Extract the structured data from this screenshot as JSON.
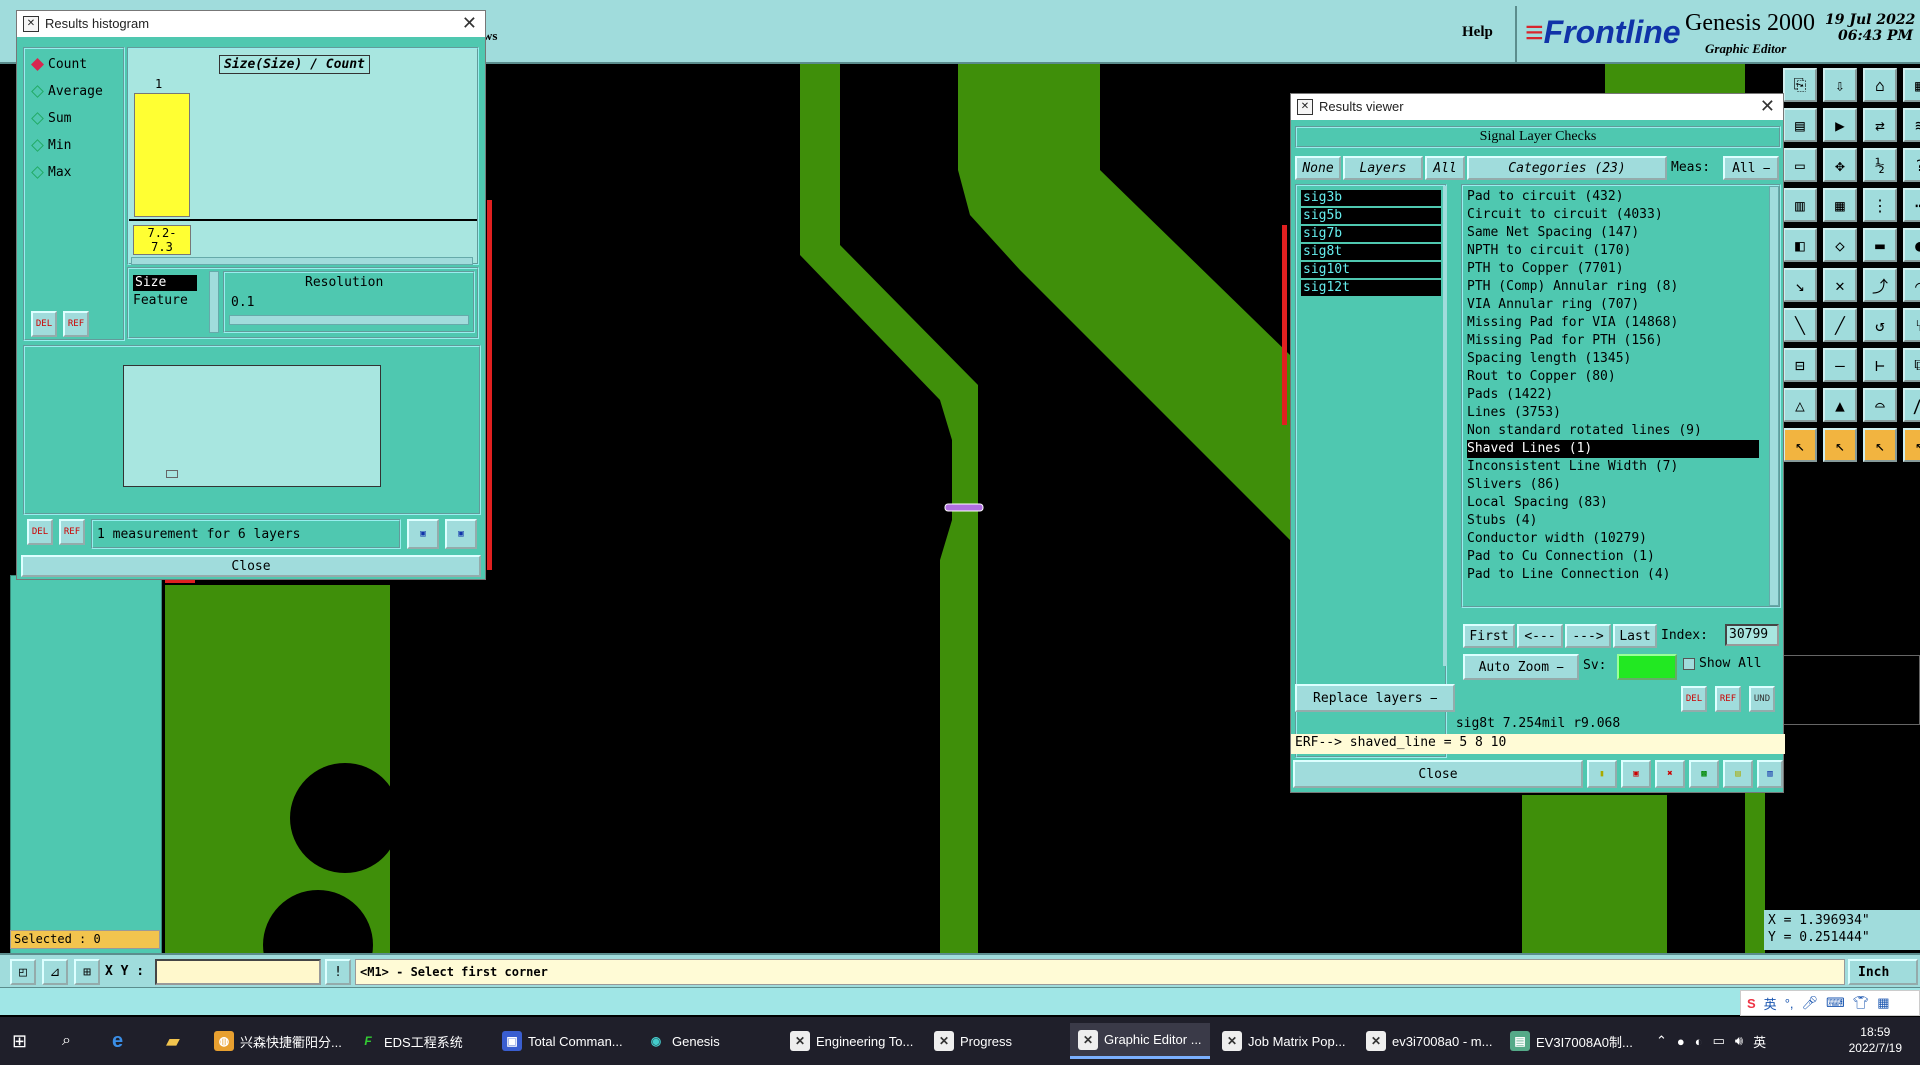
{
  "top_bar": {
    "help_label": "Help",
    "ws_fragment": "ws",
    "logo_text": "Frontline",
    "app_title": "Genesis 2000",
    "app_subtitle": "Graphic Editor",
    "date": "19 Jul 2022",
    "time": "06:43 PM"
  },
  "histogram": {
    "title": "Results histogram",
    "radio_options": [
      "Count",
      "Average",
      "Sum",
      "Min",
      "Max"
    ],
    "selected_option": "Count",
    "chart_title": "Size(Size) / Count",
    "bar_count_label": "1",
    "bar_range_label_1": "7.2-",
    "bar_range_label_2": "7.3",
    "size_label": "Size",
    "feature_label": "Feature",
    "resolution_label": "Resolution",
    "resolution_value": "0.1",
    "measure_text": "1 measurement for 6 layers",
    "close_label": "Close",
    "del_label": "DEL",
    "ref_label": "REF"
  },
  "results_viewer": {
    "title": "Results viewer",
    "header": "Signal Layer Checks",
    "none_label": "None",
    "layers_label": "Layers",
    "all_label": "All",
    "categories_label": "Categories (23)",
    "meas_label": "Meas:",
    "meas_value": "All",
    "layers": [
      "sig3b",
      "sig5b",
      "sig7b",
      "sig8t",
      "sig10t",
      "sig12t"
    ],
    "categories": [
      "Pad to circuit (432)",
      "Circuit to circuit (4033)",
      "Same Net Spacing (147)",
      "NPTH to circuit (170)",
      "PTH to Copper (7701)",
      "PTH (Comp) Annular ring (8)",
      "VIA Annular ring (707)",
      "Missing Pad for VIA (14868)",
      "Missing Pad for PTH (156)",
      "Spacing length (1345)",
      "Rout to Copper (80)",
      "Pads (1422)",
      "Lines (3753)",
      "Non standard rotated lines (9)",
      "Shaved Lines (1)",
      "Inconsistent Line Width (7)",
      "Slivers (86)",
      "Local Spacing (83)",
      "Stubs (4)",
      "Conductor width (10279)",
      "Pad to Cu Connection (1)",
      "Pad to Line Connection (4)"
    ],
    "selected_category": "Shaved Lines (1)",
    "first_label": "First",
    "prev_label": "<---",
    "next_label": "--->",
    "last_label": "Last",
    "index_label": "Index:",
    "index_value": "30799",
    "auto_zoom_label": "Auto Zoom",
    "sv_label": "Sv:",
    "show_all_label": "Show All",
    "replace_layers_label": "Replace layers",
    "status_line": "sig8t 7.254mil  r9.068",
    "erf_line": "ERF--> shaved_line = 5 8 10",
    "close_label": "Close"
  },
  "left_panel": {
    "selected_text": "Selected : 0"
  },
  "coords": {
    "x_text": "X = 1.396934\"",
    "y_text": "Y = 0.251444\""
  },
  "command_bar": {
    "xy_label": "X Y :",
    "xy_value": "",
    "message": "<M1> - Select first corner",
    "unit": "Inch"
  },
  "ime": {
    "lang": "英"
  },
  "taskbar": {
    "items": [
      {
        "label": "兴森快捷衢阳分...",
        "active": false
      },
      {
        "label": "EDS工程系统",
        "active": false
      },
      {
        "label": "Total Comman...",
        "active": false
      },
      {
        "label": "Genesis",
        "active": false
      },
      {
        "label": "Engineering To...",
        "active": false
      },
      {
        "label": "Progress",
        "active": false
      },
      {
        "label": "Graphic Editor ...",
        "active": true
      },
      {
        "label": "Job Matrix Pop...",
        "active": false
      },
      {
        "label": "ev3i7008a0 - m...",
        "active": false
      },
      {
        "label": "EV3I7008A0制...",
        "active": false
      }
    ],
    "tray_time": "18:59",
    "tray_date": "2022/7/19",
    "tray_lang": "英"
  },
  "colors": {
    "copper": "#3f8f0a",
    "panel": "#4fc8b0",
    "highlight": "#b070e0",
    "histogram_bar": "#ffff33"
  }
}
